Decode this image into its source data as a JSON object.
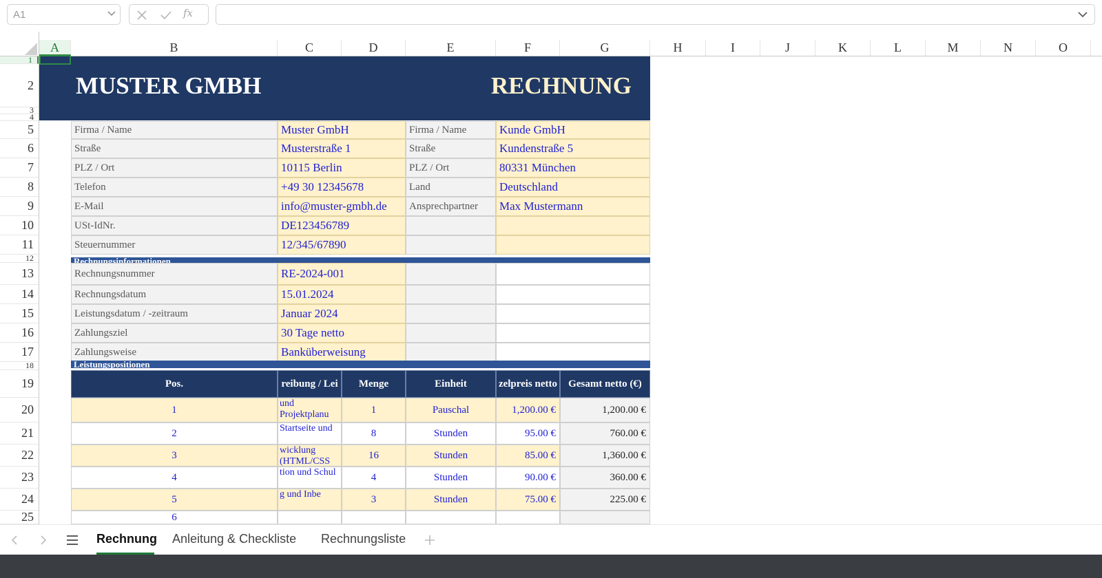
{
  "formula_bar": {
    "name_box": "A1",
    "fx_label": "fx",
    "formula": ""
  },
  "columns": [
    "A",
    "B",
    "C",
    "D",
    "E",
    "F",
    "G",
    "H",
    "I",
    "J",
    "K",
    "L",
    "M",
    "N",
    "O"
  ],
  "rows": [
    "1",
    "2",
    "3",
    "4",
    "5",
    "6",
    "7",
    "8",
    "9",
    "10",
    "11",
    "12",
    "13",
    "14",
    "15",
    "16",
    "17",
    "18",
    "19",
    "20",
    "21",
    "22",
    "23",
    "24",
    "25"
  ],
  "header": {
    "company": "MUSTER GMBH",
    "doc_title": "RECHNUNG"
  },
  "sender": [
    {
      "label": "Firma / Name",
      "value": "Muster GmbH"
    },
    {
      "label": "Straße",
      "value": "Musterstraße 1"
    },
    {
      "label": "PLZ / Ort",
      "value": "10115 Berlin"
    },
    {
      "label": "Telefon",
      "value": "+49 30 12345678"
    },
    {
      "label": "E-Mail",
      "value": "info@muster-gmbh.de"
    },
    {
      "label": "USt-IdNr.",
      "value": "DE123456789"
    },
    {
      "label": "Steuernummer",
      "value": "12/345/67890"
    }
  ],
  "recipient": [
    {
      "label": "Firma / Name",
      "value": "Kunde GmbH"
    },
    {
      "label": "Straße",
      "value": "Kundenstraße 5"
    },
    {
      "label": "PLZ / Ort",
      "value": "80331 München"
    },
    {
      "label": "Land",
      "value": "Deutschland"
    },
    {
      "label": "Ansprechpartner",
      "value": "Max Mustermann"
    },
    {
      "label": "",
      "value": ""
    },
    {
      "label": "",
      "value": ""
    }
  ],
  "sections": {
    "invoice_info": "Rechnungsinformationen",
    "items": "Leistungspositionen"
  },
  "invoice_info": [
    {
      "label": "Rechnungsnummer",
      "value": "RE-2024-001"
    },
    {
      "label": "Rechnungsdatum",
      "value": "15.01.2024"
    },
    {
      "label": "Leistungsdatum / -zeitraum",
      "value": "Januar 2024"
    },
    {
      "label": "Zahlungsziel",
      "value": "30 Tage netto"
    },
    {
      "label": "Zahlungsweise",
      "value": "Banküberweisung"
    }
  ],
  "items_header": [
    "Pos.",
    "reibung / Lei",
    "Menge",
    "Einheit",
    "zelpreis netto",
    "Gesamt netto (€)"
  ],
  "items": [
    {
      "pos": "1",
      "desc": "und Projektplanu",
      "qty": "1",
      "unit": "Pauschal",
      "price": "1,200.00 €",
      "total": "1,200.00 €"
    },
    {
      "pos": "2",
      "desc": "Startseite und",
      "qty": "8",
      "unit": "Stunden",
      "price": "95.00 €",
      "total": "760.00 €"
    },
    {
      "pos": "3",
      "desc": "wicklung (HTML/CSS",
      "qty": "16",
      "unit": "Stunden",
      "price": "85.00 €",
      "total": "1,360.00 €"
    },
    {
      "pos": "4",
      "desc": "tion und Schul",
      "qty": "4",
      "unit": "Stunden",
      "price": "90.00 €",
      "total": "360.00 €"
    },
    {
      "pos": "5",
      "desc": "g und Inbe",
      "qty": "3",
      "unit": "Stunden",
      "price": "75.00 €",
      "total": "225.00 €"
    },
    {
      "pos": "6",
      "desc": "",
      "qty": "",
      "unit": "",
      "price": "",
      "total": ""
    }
  ],
  "sheet_tabs": [
    "Rechnung",
    "Anleitung & Checkliste",
    "Rechnungsliste"
  ],
  "active_tab": "Rechnung",
  "colors": {
    "banner": "#1f3864",
    "section": "#2f5597",
    "input_fill": "#fff2cc",
    "input_text": "#1f1fd4",
    "accent": "#1e7a3a"
  }
}
